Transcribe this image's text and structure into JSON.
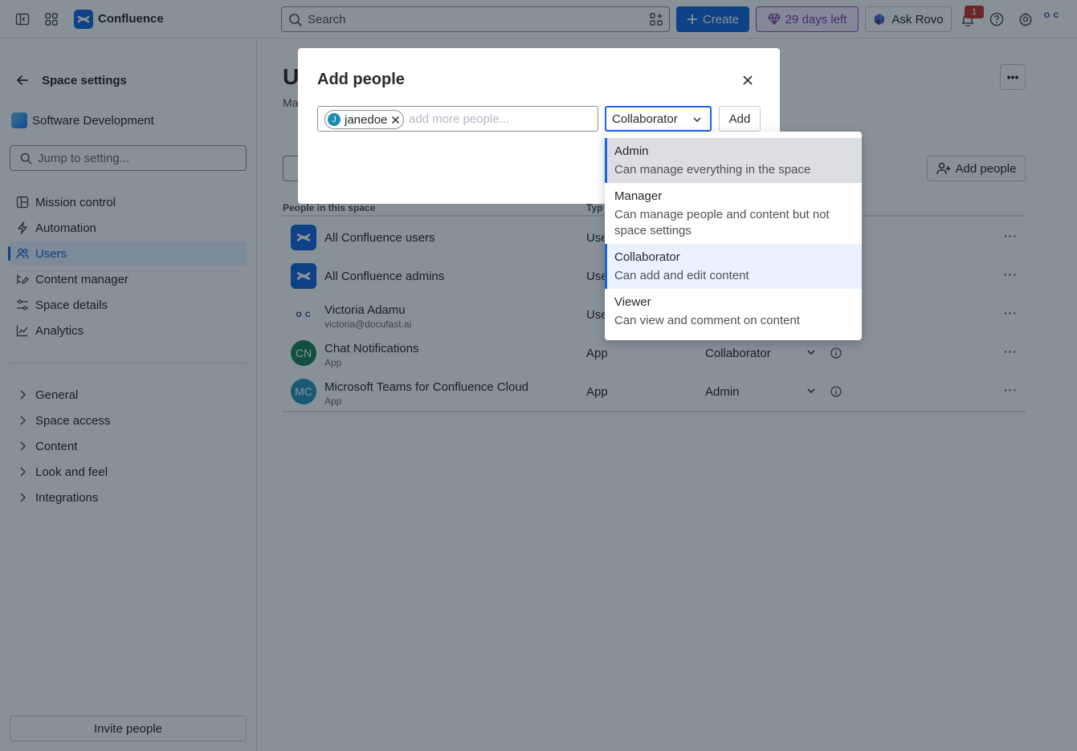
{
  "topbar": {
    "brand": "Confluence",
    "search_placeholder": "Search",
    "create_label": "Create",
    "trial_label": "29 days left",
    "rovo_label": "Ask Rovo",
    "notification_count": "1",
    "account_initials": "O C"
  },
  "sidebar": {
    "title": "Space settings",
    "space_name": "Software Development",
    "jump_placeholder": "Jump to setting...",
    "nav": [
      {
        "label": "Mission control"
      },
      {
        "label": "Automation"
      },
      {
        "label": "Users"
      },
      {
        "label": "Content manager"
      },
      {
        "label": "Space details"
      },
      {
        "label": "Analytics"
      }
    ],
    "groups": [
      {
        "label": "General"
      },
      {
        "label": "Space access"
      },
      {
        "label": "Content"
      },
      {
        "label": "Look and feel"
      },
      {
        "label": "Integrations"
      }
    ],
    "invite_label": "Invite people"
  },
  "main": {
    "title": "U",
    "subtitle": "Ma",
    "add_people_label": "Add people",
    "col_people": "People in this space",
    "col_type": "Typ",
    "rows": [
      {
        "name": "All Confluence users",
        "sub": "",
        "type": "Use",
        "role": "",
        "avatar": ""
      },
      {
        "name": "All Confluence admins",
        "sub": "",
        "type": "Use",
        "role": "",
        "avatar": ""
      },
      {
        "name": "Victoria Adamu",
        "sub": "victoria@docufast.ai",
        "type": "Use",
        "role": "",
        "avatar": "O C"
      },
      {
        "name": "Chat Notifications",
        "sub": "App",
        "type": "App",
        "role": "Collaborator",
        "avatar": "CN"
      },
      {
        "name": "Microsoft Teams for Confluence Cloud",
        "sub": "App",
        "type": "App",
        "role": "Admin",
        "avatar": "MC"
      }
    ]
  },
  "modal": {
    "title": "Add people",
    "chip_name": "janedoe",
    "chip_initial": "J",
    "people_placeholder": "add more people...",
    "role_value": "Collaborator",
    "add_label": "Add"
  },
  "dropdown": {
    "options": [
      {
        "title": "Admin",
        "desc": "Can manage everything in the space"
      },
      {
        "title": "Manager",
        "desc": "Can manage people and content but not space settings"
      },
      {
        "title": "Collaborator",
        "desc": "Can add and edit content"
      },
      {
        "title": "Viewer",
        "desc": "Can view and comment on content"
      }
    ]
  },
  "colors": {
    "brand": "#1868db",
    "trial": "#803fa5",
    "green_avatar": "#1f845a",
    "teal_avatar": "#2898bd"
  }
}
